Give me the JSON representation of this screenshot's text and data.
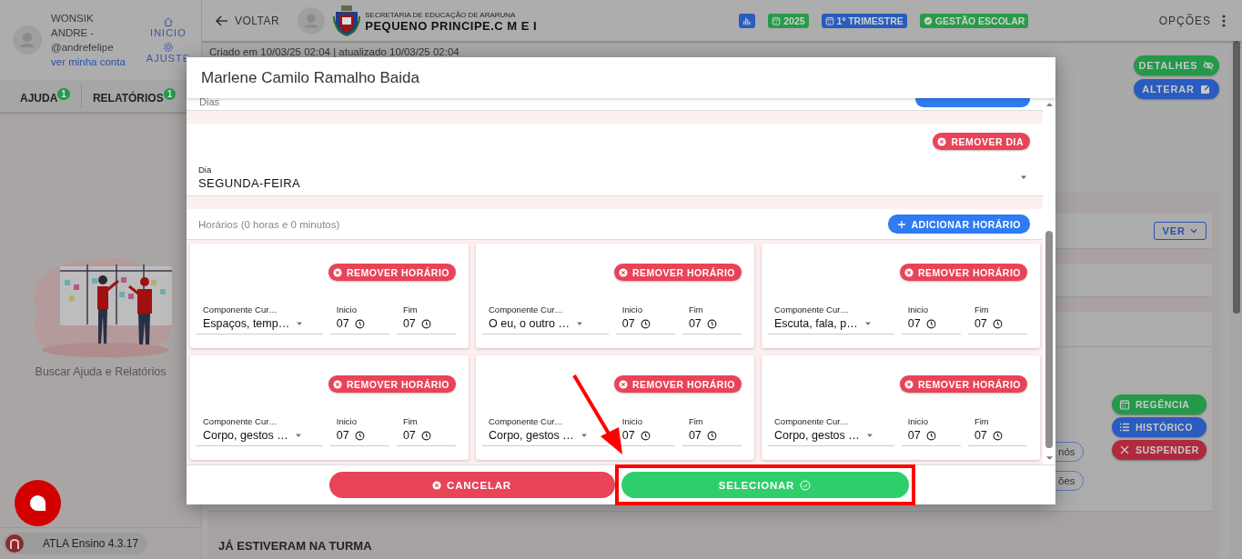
{
  "sidebar": {
    "user": {
      "name": "WONSIK ANDRE -",
      "handle": "@andrefelipe",
      "account_link": "ver minha conta"
    },
    "nav": [
      {
        "kind": "home",
        "label": "INICIO"
      },
      {
        "kind": "gear",
        "label": "AJUSTE"
      }
    ],
    "tabs": [
      {
        "label": "AJUDA",
        "badge": "1"
      },
      {
        "label": "RELATÓRIOS",
        "badge": "1"
      }
    ],
    "empty_message": "Buscar Ajuda e Relatórios",
    "version": "ATLA Ensino 4.3.17"
  },
  "header": {
    "back": "VOLTAR",
    "org": "SECRETARIA DE EDUCAÇÃO DE ARARUNA",
    "school": "PEQUENO PRINCIPE.C M E I",
    "badges": [
      {
        "kind": "chart",
        "color": "#2a5bbf"
      },
      {
        "kind": "calendar",
        "label": "2025",
        "color": "#2a9a4a"
      },
      {
        "kind": "calendar",
        "label": "1º TRIMESTRE",
        "color": "#2a5bbf"
      },
      {
        "kind": "check",
        "label": "GESTÃO ESCOLAR",
        "color": "#2a9a4a"
      }
    ],
    "options": "OPÇÕES"
  },
  "page": {
    "meta": "Criado em 10/03/25 02:04 | atualizado 10/03/25 02:04",
    "top_actions": [
      {
        "kind": "eye",
        "label": "DETALHES",
        "color": "#23994a"
      },
      {
        "kind": "edit",
        "label": "ALTERAR",
        "color": "#2a5bbf"
      }
    ],
    "ver": "VER",
    "side_actions": [
      {
        "kind": "calendar",
        "label": "REGÊNCIA",
        "color": "#23994a"
      },
      {
        "kind": "list",
        "label": "HISTÓRICO",
        "color": "#2a5bbf"
      },
      {
        "kind": "close",
        "label": "SUSPENDER",
        "color": "#b02a3e"
      }
    ],
    "chips": [
      "nós",
      "ões"
    ],
    "section_title": "JÁ ESTIVERAM NA TURMA"
  },
  "modal": {
    "title": "Marlene Camilo Ramalho Baida",
    "days_label": "Dias",
    "remove_day": "REMOVER DIA",
    "day_field": {
      "label": "Dia",
      "value": "SEGUNDA-FEIRA"
    },
    "schedule_label": "Horários (0 horas e 0 minutos)",
    "add_button": "ADICIONAR HORÁRIO",
    "slots": [
      {
        "remove": "REMOVER HORÁRIO",
        "component_label": "Componente Cur…",
        "component": "Espaços, temp…",
        "start_label": "Inicio",
        "start": "07",
        "end_label": "Fim",
        "end": "07"
      },
      {
        "remove": "REMOVER HORÁRIO",
        "component_label": "Componente Cur…",
        "component": "O eu, o outro …",
        "start_label": "Inicio",
        "start": "07",
        "end_label": "Fim",
        "end": "07"
      },
      {
        "remove": "REMOVER HORÁRIO",
        "component_label": "Componente Cur…",
        "component": "Escuta, fala, p…",
        "start_label": "Inicio",
        "start": "07",
        "end_label": "Fim",
        "end": "07"
      },
      {
        "remove": "REMOVER HORÁRIO",
        "component_label": "Componente Cur…",
        "component": "Corpo, gestos …",
        "start_label": "Inicio",
        "start": "07",
        "end_label": "Fim",
        "end": "07"
      },
      {
        "remove": "REMOVER HORÁRIO",
        "component_label": "Componente Cur…",
        "component": "Corpo, gestos …",
        "start_label": "Inicio",
        "start": "07",
        "end_label": "Fim",
        "end": "07"
      },
      {
        "remove": "REMOVER HORÁRIO",
        "component_label": "Componente Cur…",
        "component": "Corpo, gestos …",
        "start_label": "Inicio",
        "start": "07",
        "end_label": "Fim",
        "end": "07"
      }
    ],
    "cancel": "CANCELAR",
    "confirm": "SELECIONAR"
  }
}
